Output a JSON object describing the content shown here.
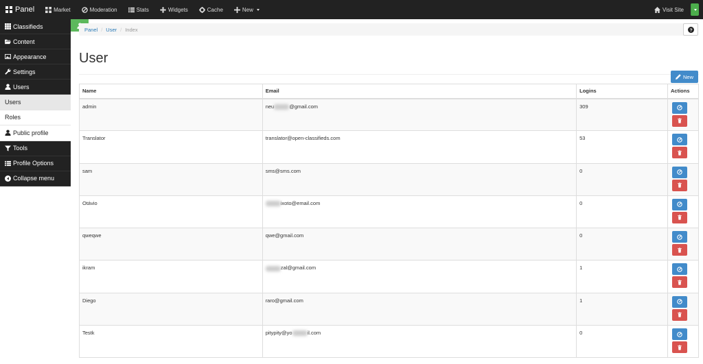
{
  "topbar": {
    "brand": "Panel",
    "nav": [
      {
        "label": "Market",
        "icon": "grid-icon"
      },
      {
        "label": "Moderation",
        "icon": "ban-icon"
      },
      {
        "label": "Stats",
        "icon": "list-icon"
      },
      {
        "label": "Widgets",
        "icon": "move-icon"
      },
      {
        "label": "Cache",
        "icon": "gear-icon"
      },
      {
        "label": "New",
        "icon": "plus-icon"
      }
    ],
    "visit_site": "Visit Site"
  },
  "sidebar": {
    "items": [
      {
        "label": "Classifieds",
        "icon": "th-icon"
      },
      {
        "label": "Content",
        "icon": "folder-open-icon"
      },
      {
        "label": "Appearance",
        "icon": "picture-icon"
      },
      {
        "label": "Settings",
        "icon": "wrench-icon"
      },
      {
        "label": "Users",
        "icon": "user-icon"
      }
    ],
    "sub": [
      {
        "label": "Users"
      },
      {
        "label": "Roles"
      },
      {
        "label": "Public profile",
        "icon": "user-icon"
      }
    ],
    "items2": [
      {
        "label": "Tools",
        "icon": "filter-icon"
      },
      {
        "label": "Profile Options",
        "icon": "list-icon"
      },
      {
        "label": "Collapse menu",
        "icon": "circle-left-icon"
      }
    ]
  },
  "breadcrumb": {
    "panel": "Panel",
    "user": "User",
    "current": "Index"
  },
  "page_title": "User",
  "new_button": "New",
  "table": {
    "headers": {
      "name": "Name",
      "email": "Email",
      "logins": "Logins",
      "actions": "Actions"
    },
    "rows": [
      {
        "name": "admin",
        "email_pre": "neu",
        "email_post": "@gmail.com",
        "logins": "309"
      },
      {
        "name": "Translator",
        "email_pre": "translator@open-classifieds.com",
        "email_post": "",
        "logins": "53"
      },
      {
        "name": "sam",
        "email_pre": "sms@sms.com",
        "email_post": "",
        "logins": "0"
      },
      {
        "name": "Otávio",
        "email_pre": "",
        "email_post": "ixoto@email.com",
        "logins": "0"
      },
      {
        "name": "qweqwe",
        "email_pre": "qwe@gmail.com",
        "email_post": "",
        "logins": "0"
      },
      {
        "name": "ikram",
        "email_pre": "",
        "email_post": "zal@gmail.com",
        "logins": "1"
      },
      {
        "name": "Diego",
        "email_pre": "raro@gmail.com",
        "email_post": "",
        "logins": "1"
      },
      {
        "name": "Testk",
        "email_pre": "pitypity@yo",
        "email_post": "il.com",
        "logins": "0"
      }
    ]
  },
  "colors": {
    "primary": "#428bca",
    "danger": "#d9534f",
    "success": "#5cb85c",
    "nav": "#222222"
  }
}
